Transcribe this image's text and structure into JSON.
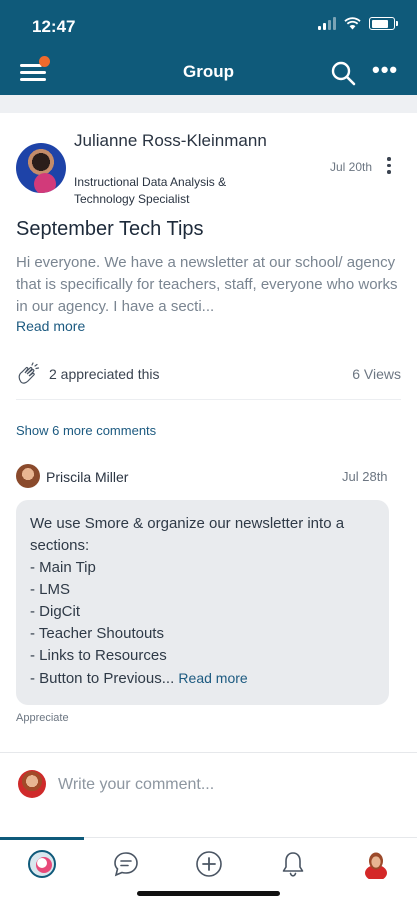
{
  "status_bar": {
    "time": "12:47"
  },
  "header": {
    "title": "Group"
  },
  "post": {
    "author_name": "Julianne Ross-Kleinmann",
    "author_title": "Instructional Data Analysis & Technology Specialist",
    "date": "Jul 20th",
    "title": "September Tech Tips",
    "body": "Hi everyone. We have a newsletter at our school/ agency that is specifically for teachers, staff, everyone who works in our agency. I have a secti...",
    "read_more": "Read more",
    "appreciated": "2 appreciated this",
    "views": "6 Views",
    "show_more_comments": "Show 6 more comments"
  },
  "comment": {
    "author": "Priscila Miller",
    "date": "Jul 28th",
    "lines": [
      "We use Smore & organize our newsletter into a",
      "sections:",
      "- Main Tip",
      "- LMS",
      "- DigCit",
      "- Teacher Shoutouts",
      "- Links to Resources",
      "- Button to Previous..."
    ],
    "read_more": "Read more",
    "appreciate": "Appreciate"
  },
  "composer": {
    "placeholder": "Write your comment..."
  },
  "icons": {
    "menu": "hamburger-menu-icon",
    "search": "search-icon",
    "more": "more-horizontal-icon",
    "clap": "clap-icon",
    "tabs": [
      "home-icon",
      "chat-icon",
      "plus-circle-icon",
      "bell-icon",
      "profile-avatar"
    ]
  },
  "colors": {
    "header": "#0f5a7a",
    "link": "#1c5a80",
    "notification": "#f06a2c",
    "bubble": "#e9ebee"
  }
}
